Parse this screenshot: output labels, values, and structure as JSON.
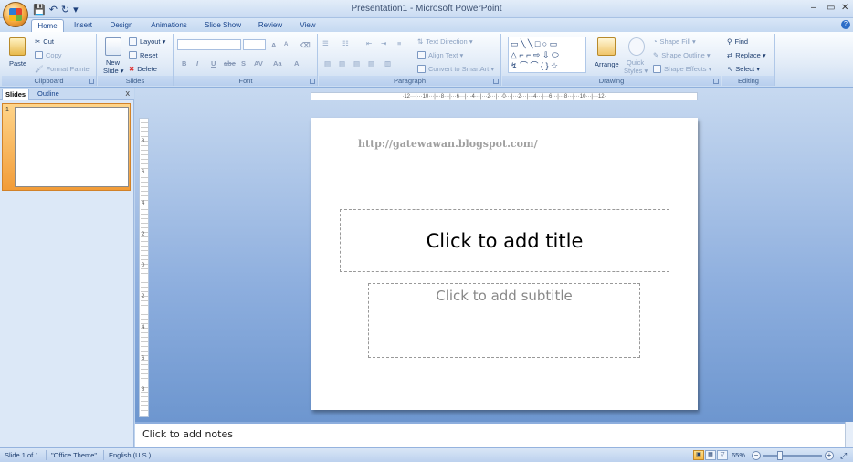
{
  "window": {
    "title": "Presentation1 - Microsoft PowerPoint",
    "controls": {
      "minimize": "–",
      "restore": "▭",
      "close": "✕"
    }
  },
  "qat": {
    "save_icon": "save-icon",
    "undo_icon": "undo-icon",
    "redo_icon": "redo-icon",
    "customize": "▾"
  },
  "tabs": [
    "Home",
    "Insert",
    "Design",
    "Animations",
    "Slide Show",
    "Review",
    "View"
  ],
  "active_tab": "Home",
  "ribbon": {
    "clipboard": {
      "label": "Clipboard",
      "paste": "Paste",
      "cut": "Cut",
      "copy": "Copy",
      "format_painter": "Format Painter"
    },
    "slides": {
      "label": "Slides",
      "new_slide": "New",
      "new_slide_2": "Slide ▾",
      "layout": "Layout ▾",
      "reset": "Reset",
      "delete": "Delete"
    },
    "font": {
      "label": "Font",
      "grow": "A",
      "shrink": "A",
      "clear": "⌫",
      "bold": "B",
      "italic": "I",
      "underline": "U",
      "strike": "abe",
      "shadow": "S",
      "spacing": "AV",
      "case": "Aa",
      "color": "A"
    },
    "paragraph": {
      "label": "Paragraph",
      "text_direction": "Text Direction ▾",
      "align_text": "Align Text ▾",
      "convert_smartart": "Convert to SmartArt ▾"
    },
    "drawing": {
      "label": "Drawing",
      "arrange": "Arrange",
      "quick_styles": "Quick",
      "quick_styles_2": "Styles ▾",
      "shape_fill": "Shape Fill ▾",
      "shape_outline": "Shape Outline ▾",
      "shape_effects": "Shape Effects ▾"
    },
    "editing": {
      "label": "Editing",
      "find": "Find",
      "replace": "Replace ▾",
      "select": "Select ▾"
    }
  },
  "left_pane": {
    "tab_slides": "Slides",
    "tab_outline": "Outline",
    "close": "x",
    "slide_number": "1"
  },
  "rulers": {
    "horizontal": "·12···|···10···|···8···|···6···|···4···|···2···|···0···|···2···|···4···|···6···|···8···|···10···|···12·",
    "vertical": [
      "8",
      "6",
      "4",
      "2",
      "0",
      "2",
      "4",
      "6",
      "8"
    ]
  },
  "slide": {
    "watermark": "http://gatewawan.blogspot.com/",
    "title_placeholder": "Click to add title",
    "subtitle_placeholder": "Click to add subtitle"
  },
  "notes": {
    "placeholder": "Click to add notes"
  },
  "status": {
    "slide": "Slide 1 of 1",
    "theme": "\"Office Theme\"",
    "language": "English (U.S.)",
    "zoom": "65%",
    "zoom_percent": 65,
    "view": "normal"
  }
}
